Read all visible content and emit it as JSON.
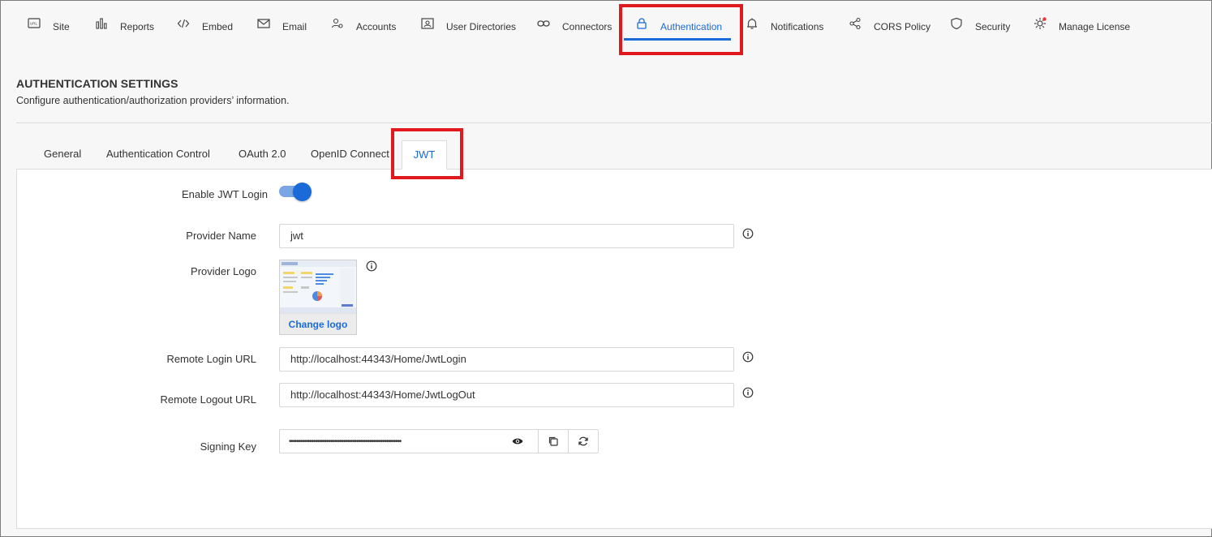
{
  "nav": {
    "items": [
      {
        "label": "Site",
        "icon": "url-icon"
      },
      {
        "label": "Reports",
        "icon": "bar-chart-icon"
      },
      {
        "label": "Embed",
        "icon": "code-icon"
      },
      {
        "label": "Email",
        "icon": "email-icon"
      },
      {
        "label": "Accounts",
        "icon": "users-gear-icon"
      },
      {
        "label": "User Directories",
        "icon": "id-card-icon"
      },
      {
        "label": "Connectors",
        "icon": "link-icon"
      },
      {
        "label": "Authentication",
        "icon": "lock-icon",
        "active": true
      },
      {
        "label": "Notifications",
        "icon": "bell-icon"
      },
      {
        "label": "CORS Policy",
        "icon": "share-icon"
      },
      {
        "label": "Security",
        "icon": "shield-icon"
      },
      {
        "label": "Manage License",
        "icon": "license-gear-icon"
      }
    ]
  },
  "header": {
    "title": "AUTHENTICATION SETTINGS",
    "subtitle": "Configure authentication/authorization providers’ information."
  },
  "tabs": [
    {
      "label": "General"
    },
    {
      "label": "Authentication Control"
    },
    {
      "label": "OAuth 2.0"
    },
    {
      "label": "OpenID Connect"
    },
    {
      "label": "JWT",
      "active": true
    }
  ],
  "form": {
    "enable_label": "Enable JWT Login",
    "enable_value": true,
    "provider_name_label": "Provider Name",
    "provider_name_value": "jwt",
    "provider_logo_label": "Provider Logo",
    "change_logo_label": "Change logo",
    "remote_login_label": "Remote Login URL",
    "remote_login_value": "http://localhost:44343/Home/JwtLogin",
    "remote_logout_label": "Remote Logout URL",
    "remote_logout_value": "http://localhost:44343/Home/JwtLogOut",
    "signing_key_label": "Signing Key",
    "signing_key_value": "••••••••••••••••••••••••••••••••••••••••••••••••••••••••••••"
  },
  "colors": {
    "accent": "#1a6ad9",
    "highlight": "#e0191e",
    "background": "#f7f7f7"
  }
}
